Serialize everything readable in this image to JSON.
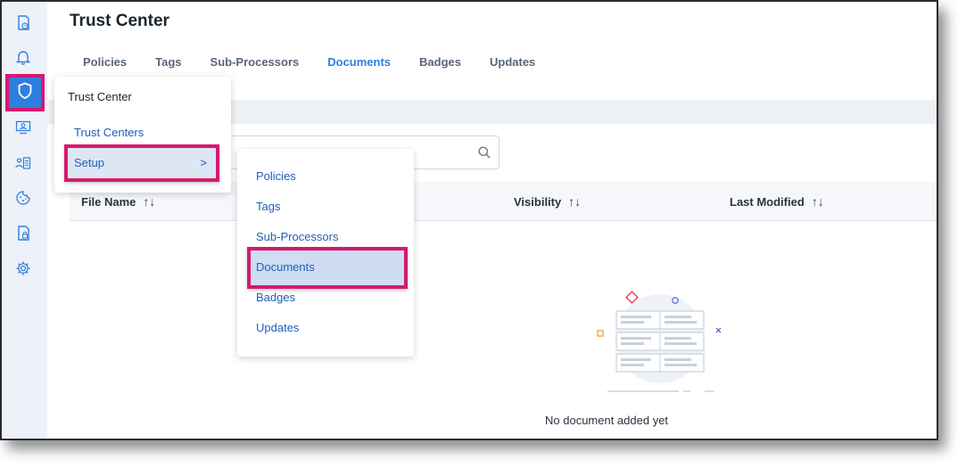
{
  "page": {
    "title": "Trust Center"
  },
  "tabs": [
    {
      "label": "Policies",
      "active": false
    },
    {
      "label": "Tags",
      "active": false
    },
    {
      "label": "Sub-Processors",
      "active": false
    },
    {
      "label": "Documents",
      "active": true
    },
    {
      "label": "Badges",
      "active": false
    },
    {
      "label": "Updates",
      "active": false
    }
  ],
  "rail": {
    "icons": [
      "report-clock-icon",
      "bell-icon",
      "shield-icon",
      "monitor-user-icon",
      "user-list-icon",
      "cookie-icon",
      "document-lock-icon",
      "gear-icon"
    ],
    "active": "shield-icon"
  },
  "table": {
    "columns": [
      {
        "label": "File Name"
      },
      {
        "label": "Visibility"
      },
      {
        "label": "Last Modified"
      }
    ],
    "empty_message": "No document added yet"
  },
  "menu": {
    "title": "Trust Center",
    "items": [
      "Trust Centers",
      "Setup"
    ]
  },
  "submenu": {
    "items": [
      "Policies",
      "Tags",
      "Sub-Processors",
      "Documents",
      "Badges",
      "Updates"
    ],
    "highlighted": "Documents"
  },
  "colors": {
    "accent": "#2f7fe0",
    "highlight_border": "#d6196f",
    "link": "#2060b5"
  }
}
